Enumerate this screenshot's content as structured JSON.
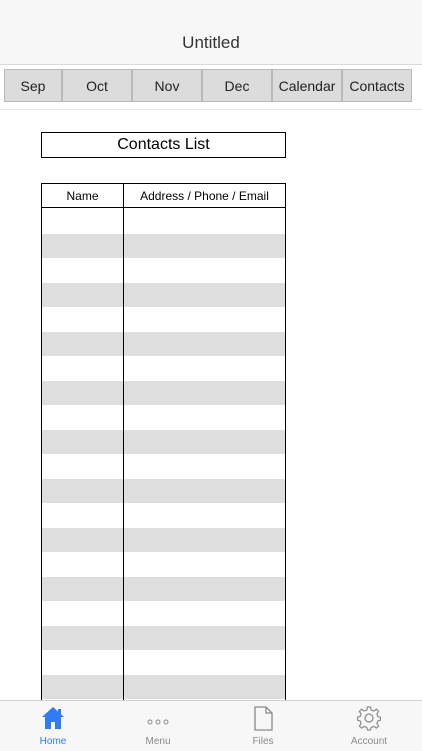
{
  "header": {
    "title": "Untitled"
  },
  "tabs": [
    {
      "label": "Sep"
    },
    {
      "label": "Oct"
    },
    {
      "label": "Nov"
    },
    {
      "label": "Dec"
    },
    {
      "label": "Calendar"
    },
    {
      "label": "Contacts"
    }
  ],
  "contacts": {
    "title": "Contacts List",
    "columns": [
      "Name",
      "Address / Phone / Email"
    ]
  },
  "bottom_nav": {
    "items": [
      {
        "label": "Home",
        "icon": "home-icon",
        "active": true
      },
      {
        "label": "Menu",
        "icon": "ellipsis-icon",
        "active": false
      },
      {
        "label": "Files",
        "icon": "file-icon",
        "active": false
      },
      {
        "label": "Account",
        "icon": "gear-icon",
        "active": false
      }
    ]
  },
  "colors": {
    "accent": "#2f7cf6",
    "row_shade": "#dedede"
  }
}
